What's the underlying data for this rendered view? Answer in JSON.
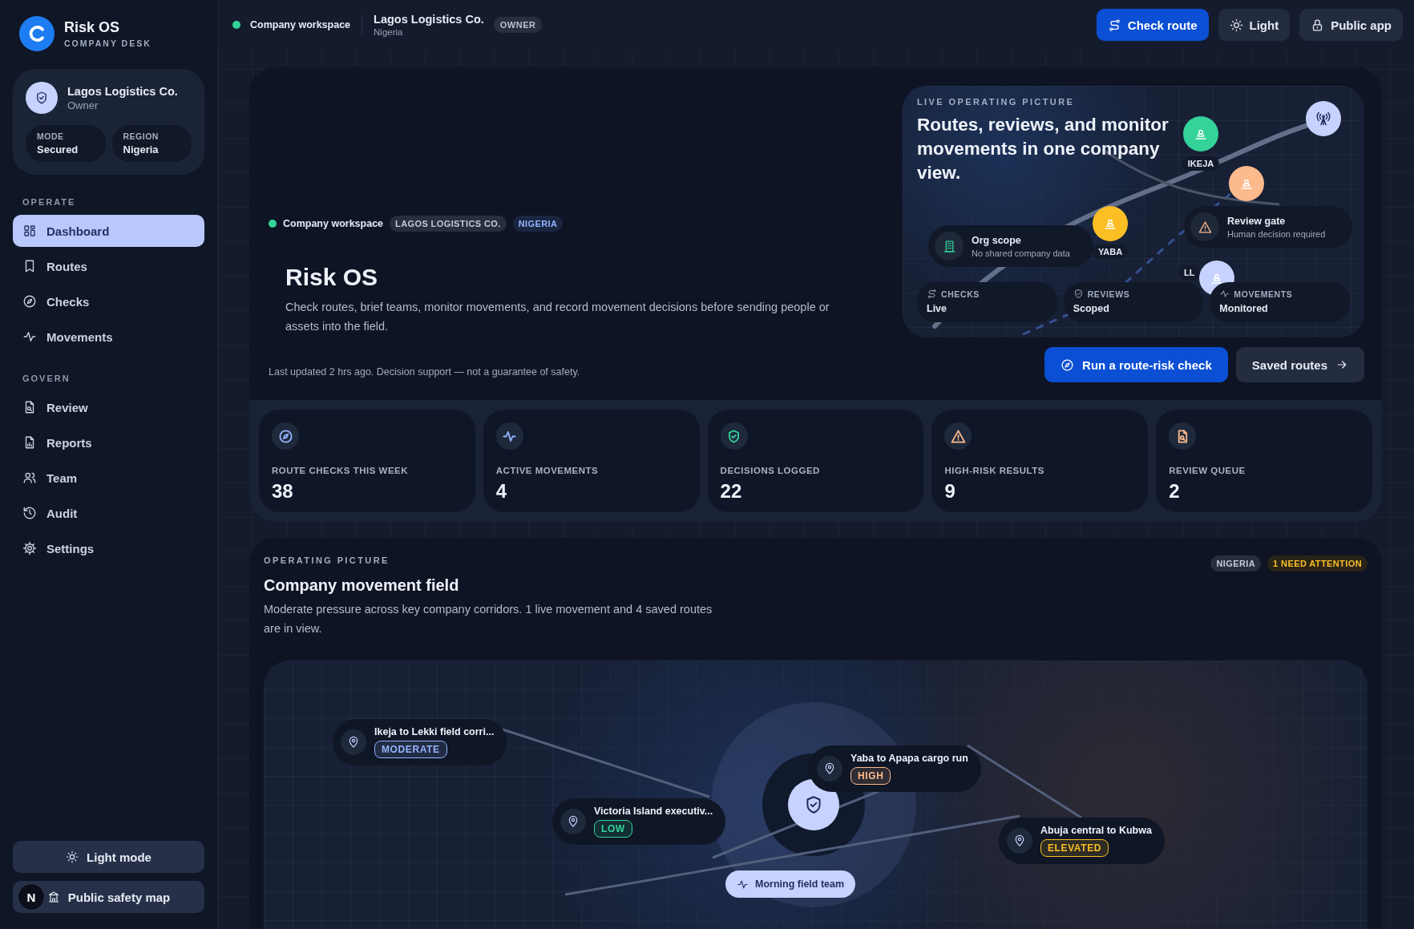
{
  "sidebar": {
    "brand": {
      "name": "Risk OS",
      "subtitle": "COMPANY DESK"
    },
    "org": {
      "name": "Lagos Logistics Co.",
      "role": "Owner",
      "fields": [
        {
          "label": "MODE",
          "value": "Secured"
        },
        {
          "label": "REGION",
          "value": "Nigeria"
        }
      ]
    },
    "sections": [
      {
        "title": "OPERATE",
        "items": [
          {
            "label": "Dashboard",
            "selected": true
          },
          {
            "label": "Routes",
            "selected": false
          },
          {
            "label": "Checks",
            "selected": false
          },
          {
            "label": "Movements",
            "selected": false
          }
        ]
      },
      {
        "title": "GOVERN",
        "items": [
          {
            "label": "Review",
            "selected": false
          },
          {
            "label": "Reports",
            "selected": false
          },
          {
            "label": "Team",
            "selected": false
          },
          {
            "label": "Audit",
            "selected": false
          },
          {
            "label": "Settings",
            "selected": false
          }
        ]
      }
    ],
    "light_mode_button": "Light mode",
    "dev_badge": "N",
    "public_map_button": "Public safety map"
  },
  "topbar": {
    "workspace": "Company workspace",
    "company": "Lagos Logistics Co.",
    "country": "Nigeria",
    "role_badge": "OWNER",
    "buttons": [
      {
        "label": "Check route",
        "kind": "primary"
      },
      {
        "label": "Light",
        "kind": "secondary"
      },
      {
        "label": "Public app",
        "kind": "secondary"
      }
    ]
  },
  "hero": {
    "workspace": "Company workspace",
    "tags": [
      {
        "label": "LAGOS LOGISTICS CO.",
        "kind": "neutral"
      },
      {
        "label": "NIGERIA",
        "kind": "accent"
      }
    ],
    "title": "Risk OS",
    "description": "Check routes, brief teams, monitor movements, and record movement decisions before sending people or assets into the field.",
    "footnote": "Last updated 2 hrs ago. Decision support — not a guarantee of safety.",
    "live_panel": {
      "eyebrow": "LIVE OPERATING PICTURE",
      "heading": "Routes, reviews, and monitor movements in one company view.",
      "pins": [
        {
          "label": "IKEJA",
          "color": "#34d399"
        },
        {
          "label": "YABA",
          "color": "#fbbf24"
        },
        {
          "color": "#fdba8c"
        },
        {
          "label": "LL",
          "color": "#c7d2fe"
        }
      ],
      "cards": [
        {
          "title": "Org scope",
          "subtitle": "No shared company data"
        },
        {
          "title": "Review gate",
          "subtitle": "Human decision required"
        }
      ],
      "statuses": [
        {
          "label": "CHECKS",
          "value": "Live"
        },
        {
          "label": "REVIEWS",
          "value": "Scoped"
        },
        {
          "label": "MOVEMENTS",
          "value": "Monitored"
        }
      ]
    },
    "actions": [
      {
        "label": "Run a route-risk check",
        "kind": "primary"
      },
      {
        "label": "Saved routes",
        "kind": "secondary"
      }
    ]
  },
  "stats": [
    {
      "label": "ROUTE CHECKS THIS WEEK",
      "value": "38",
      "color": "#93b4ff"
    },
    {
      "label": "ACTIVE MOVEMENTS",
      "value": "4",
      "color": "#93b4ff"
    },
    {
      "label": "DECISIONS LOGGED",
      "value": "22",
      "color": "#34d399"
    },
    {
      "label": "HIGH-RISK RESULTS",
      "value": "9",
      "color": "#fdba8c"
    },
    {
      "label": "REVIEW QUEUE",
      "value": "2",
      "color": "#fdba8c"
    }
  ],
  "operating_picture": {
    "eyebrow": "OPERATING PICTURE",
    "title": "Company movement field",
    "description": "Moderate pressure across key company corridors. 1 live movement and 4 saved routes are in view.",
    "badges": [
      {
        "label": "NIGERIA",
        "kind": "neutral"
      },
      {
        "label": "1 NEED ATTENTION",
        "kind": "warning"
      }
    ],
    "routes": [
      {
        "name": "Ikeja to Lekki field corri...",
        "risk": "MODERATE",
        "color": "#93b4ff"
      },
      {
        "name": "Victoria Island executiv...",
        "risk": "LOW",
        "color": "#34d399"
      },
      {
        "name": "Yaba to Apapa cargo run",
        "risk": "HIGH",
        "color": "#fdba8c"
      },
      {
        "name": "Abuja central to Kubwa",
        "risk": "ELEVATED",
        "color": "#fbbf24"
      }
    ],
    "team_chip": "Morning field team"
  }
}
